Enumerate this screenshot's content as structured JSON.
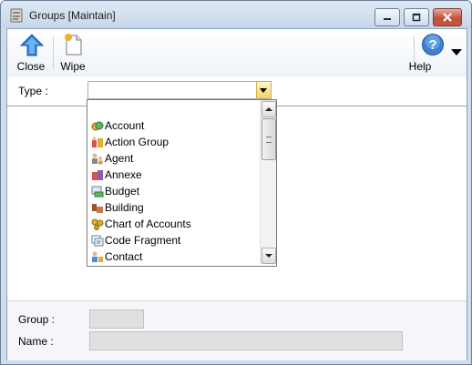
{
  "window": {
    "title": "Groups [Maintain]",
    "controls": [
      "minimize",
      "maximize",
      "close"
    ]
  },
  "toolbar": {
    "close_label": "Close",
    "wipe_label": "Wipe",
    "help_label": "Help"
  },
  "filter": {
    "type_label": "Type :",
    "type_value": ""
  },
  "dropdown": {
    "items": [
      {
        "label": "Account",
        "icon": "account-icon"
      },
      {
        "label": "Action Group",
        "icon": "action-group-icon"
      },
      {
        "label": "Agent",
        "icon": "agent-icon"
      },
      {
        "label": "Annexe",
        "icon": "annexe-icon"
      },
      {
        "label": "Budget",
        "icon": "budget-icon"
      },
      {
        "label": "Building",
        "icon": "building-icon"
      },
      {
        "label": "Chart of Accounts",
        "icon": "chart-of-accounts-icon"
      },
      {
        "label": "Code Fragment",
        "icon": "code-fragment-icon"
      },
      {
        "label": "Contact",
        "icon": "contact-icon"
      }
    ]
  },
  "form": {
    "group_label": "Group :",
    "group_value": "",
    "name_label": "Name :",
    "name_value": ""
  },
  "colors": {
    "title_bg": "#c6d6ea",
    "close_button": "#c4523c",
    "dropdown_button": "#f3d25e",
    "disabled_field": "#e0e0e0"
  }
}
